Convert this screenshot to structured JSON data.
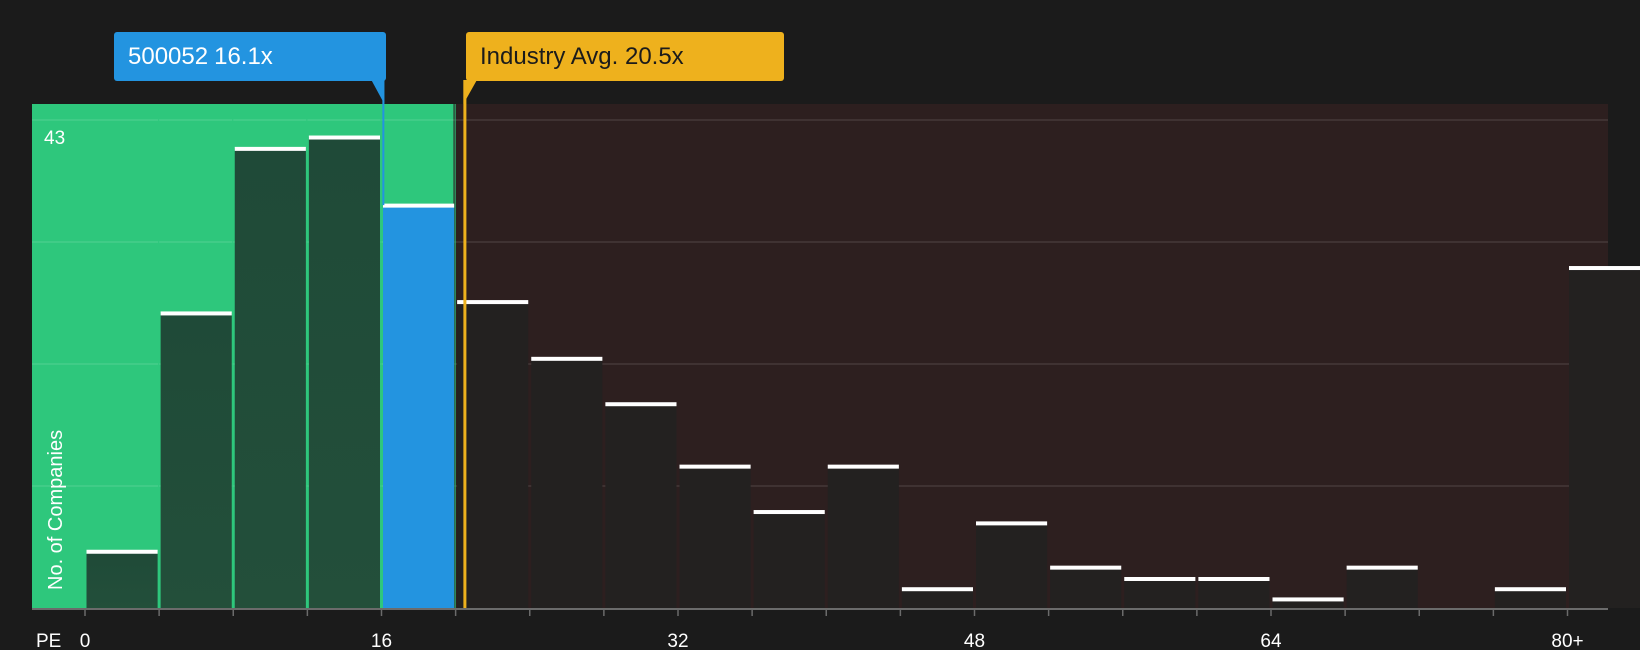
{
  "chart_data": {
    "type": "bar",
    "x_axis_label": "PE",
    "y_axis_label": "No. of Companies",
    "y_max_label": "43",
    "x_tick_labels": [
      "0",
      "16",
      "32",
      "48",
      "64",
      "80+"
    ],
    "bins": [
      {
        "from": 0,
        "to": 4,
        "count": 5
      },
      {
        "from": 4,
        "to": 8,
        "count": 26
      },
      {
        "from": 8,
        "to": 12,
        "count": 40.5
      },
      {
        "from": 12,
        "to": 16,
        "count": 41.5
      },
      {
        "from": 16,
        "to": 20,
        "count": 35.5
      },
      {
        "from": 20,
        "to": 24,
        "count": 27
      },
      {
        "from": 24,
        "to": 28,
        "count": 22
      },
      {
        "from": 28,
        "to": 32,
        "count": 18
      },
      {
        "from": 32,
        "to": 36,
        "count": 12.5
      },
      {
        "from": 36,
        "to": 40,
        "count": 8.5
      },
      {
        "from": 40,
        "to": 44,
        "count": 12.5
      },
      {
        "from": 44,
        "to": 48,
        "count": 1.7
      },
      {
        "from": 48,
        "to": 52,
        "count": 7.5
      },
      {
        "from": 52,
        "to": 56,
        "count": 3.6
      },
      {
        "from": 56,
        "to": 60,
        "count": 2.6
      },
      {
        "from": 60,
        "to": 64,
        "count": 2.6
      },
      {
        "from": 64,
        "to": 68,
        "count": 0.8
      },
      {
        "from": 68,
        "to": 72,
        "count": 3.6
      },
      {
        "from": 72,
        "to": 76,
        "count": 0
      },
      {
        "from": 76,
        "to": 80,
        "count": 1.7
      },
      {
        "from": 80,
        "to": 84,
        "count": 30
      }
    ],
    "y_range": [
      0,
      43
    ],
    "x_range": [
      0,
      80
    ],
    "stock": {
      "ticker": "500052",
      "pe": 16.1,
      "pe_label": "16.1x"
    },
    "industry_avg": {
      "label": "Industry Avg. 20.5x",
      "pe": 20.5
    },
    "grid": true,
    "colors": {
      "background": "#1b1b1b",
      "below_avg_zone": "#2ec77c",
      "above_avg_zone": "#2d1f1f",
      "stock_bar": "#2394e0",
      "industry_line": "#eeb11d",
      "bar_fill": "#232120",
      "bar_cap": "#ffffff"
    }
  }
}
